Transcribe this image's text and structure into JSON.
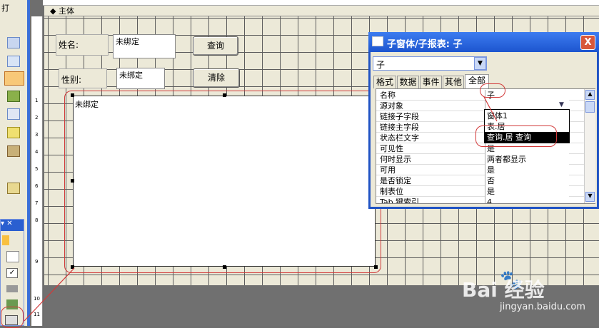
{
  "toolbar": {
    "top_label": "打"
  },
  "section": {
    "title": "主体",
    "arrow": "◆"
  },
  "form": {
    "name_label": "姓名:",
    "name_value": "未绑定",
    "gender_label": "性别:",
    "gender_value": "未绑定",
    "query_button": "查询",
    "clear_button": "清除",
    "subform_label": "未绑定"
  },
  "property_sheet": {
    "title": "子窗体/子报表: 子",
    "close": "X",
    "selected_object": "子",
    "tabs": [
      "格式",
      "数据",
      "事件",
      "其他",
      "全部"
    ],
    "active_tab": "全部",
    "rows": [
      {
        "name": "名称",
        "value": "子"
      },
      {
        "name": "源对象",
        "value": ""
      },
      {
        "name": "链接子字段",
        "value": ""
      },
      {
        "name": "链接主字段",
        "value": ""
      },
      {
        "name": "状态栏文字",
        "value": ""
      },
      {
        "name": "可见性",
        "value": "是"
      },
      {
        "name": "何时显示",
        "value": "两者都显示"
      },
      {
        "name": "可用",
        "value": "是"
      },
      {
        "name": "是否锁定",
        "value": "否"
      },
      {
        "name": "制表位",
        "value": "是"
      },
      {
        "name": "Tab 键索引",
        "value": "4"
      }
    ],
    "dropdown_options": [
      "窗体1",
      "表.居",
      "查询.居 查询"
    ],
    "dropdown_selected": "查询.居 查询"
  },
  "ruler_marks": [
    "1",
    "2",
    "3",
    "4",
    "5",
    "6",
    "7",
    "8",
    "9",
    "10",
    "11"
  ],
  "watermark": {
    "brand": "Bai  经验",
    "url": "jingyan.baidu.com"
  },
  "colors": {
    "annotation": "#d23a3a",
    "titlebar": "#2053c4"
  }
}
